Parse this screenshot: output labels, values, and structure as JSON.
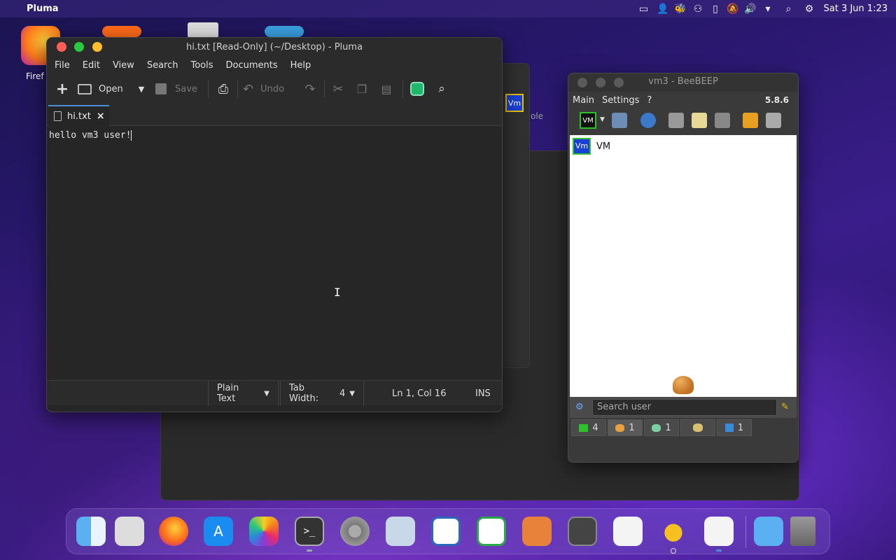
{
  "topbar": {
    "app_name": "Pluma",
    "clock": "Sat 3 Jun  1:23"
  },
  "desktop": {
    "firefox_label": "Firef"
  },
  "pluma": {
    "title": "hi.txt [Read-Only] (~/Desktop) - Pluma",
    "menu": [
      "File",
      "Edit",
      "View",
      "Search",
      "Tools",
      "Documents",
      "Help"
    ],
    "toolbar": {
      "open_label": "Open",
      "save_label": "Save",
      "undo_label": "Undo"
    },
    "tab": {
      "label": "hi.txt",
      "close": "×"
    },
    "content": "hello vm3 user!",
    "status": {
      "language": "Plain Text",
      "tab_width_label": "Tab Width:",
      "tab_width_value": "4",
      "position": "Ln 1, Col 16",
      "mode": "INS"
    }
  },
  "background_window": {
    "partial_text": "ole",
    "avatar": "Vm"
  },
  "beebeep": {
    "title": "vm3 - BeeBEEP",
    "menu": [
      "Main",
      "Settings",
      "?"
    ],
    "version": "5.8.6",
    "status_avatar": "VM",
    "user_avatar": "Vm",
    "user_name": "VM",
    "search_placeholder": "Search user",
    "tabs": [
      {
        "icon": "chat-icon",
        "count": "4"
      },
      {
        "icon": "users-icon",
        "count": "1"
      },
      {
        "icon": "groups-icon",
        "count": "1"
      },
      {
        "icon": "network-icon",
        "count": ""
      },
      {
        "icon": "file-share-icon",
        "count": "1"
      }
    ]
  },
  "dock": {
    "items": [
      "finder",
      "launchpad",
      "firefox",
      "app-store",
      "photos",
      "terminal",
      "system-settings",
      "image-capture",
      "writer",
      "spreadsheet",
      "preview",
      "tape",
      "text-edit",
      "beebeep",
      "pluma",
      "downloads",
      "trash"
    ]
  },
  "colors": {
    "accent": "#4a90d9",
    "close": "#ff5f57",
    "minimize": "#febc2e",
    "maximize": "#28c840"
  }
}
